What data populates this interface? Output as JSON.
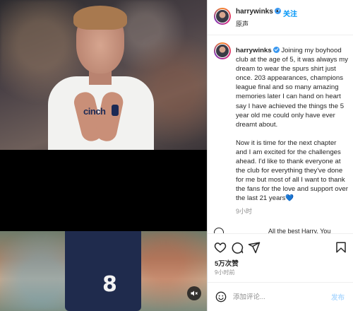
{
  "header": {
    "username": "harrywinks",
    "separator": "•",
    "follow_label": "关注",
    "audio_label": "原声"
  },
  "caption": {
    "username": "harrywinks",
    "paragraph1": "Joining my boyhood club at the age of 5, it was always my dream to wear the spurs shirt just once. 203 appearances, champions league final and so many amazing memories later I can hand on heart say I have achieved the things the 5 year old me could only have ever dreamt about.",
    "paragraph2": "Now it is time for the next chapter and I am excited for the challenges ahead. I'd like to thank everyone at the club for everything they've done for me but most of all I want to thank the fans for the love and support over the last 21 years💙",
    "time": "9小时"
  },
  "next_comment": {
    "text": "All the best Harry. You"
  },
  "media": {
    "shirt_sponsor": "cinch",
    "shorts_number": "8"
  },
  "actions": {
    "likes": "5万次赞",
    "post_time": "9小时前"
  },
  "comment_box": {
    "placeholder": "添加评论...",
    "post_label": "发布"
  },
  "colors": {
    "accent": "#0095f6",
    "verified": "#3897f0",
    "post_disabled": "#b3dbff",
    "secondary_text": "#8e8e8e"
  },
  "icons": [
    "verified-badge-icon",
    "heart-icon",
    "comment-icon",
    "share-icon",
    "bookmark-icon",
    "emoji-icon",
    "mute-icon"
  ]
}
